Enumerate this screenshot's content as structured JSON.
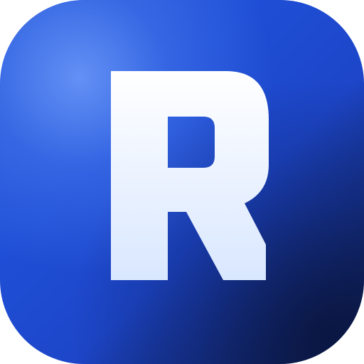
{
  "icon": {
    "letter": "R",
    "letter_color_top": "#ffffff",
    "letter_color_bottom": "#d9e7ff",
    "background_colors": [
      "#2a5ad8",
      "#1f4fd6",
      "#12266a"
    ],
    "highlight_color": "#78a5ff"
  }
}
